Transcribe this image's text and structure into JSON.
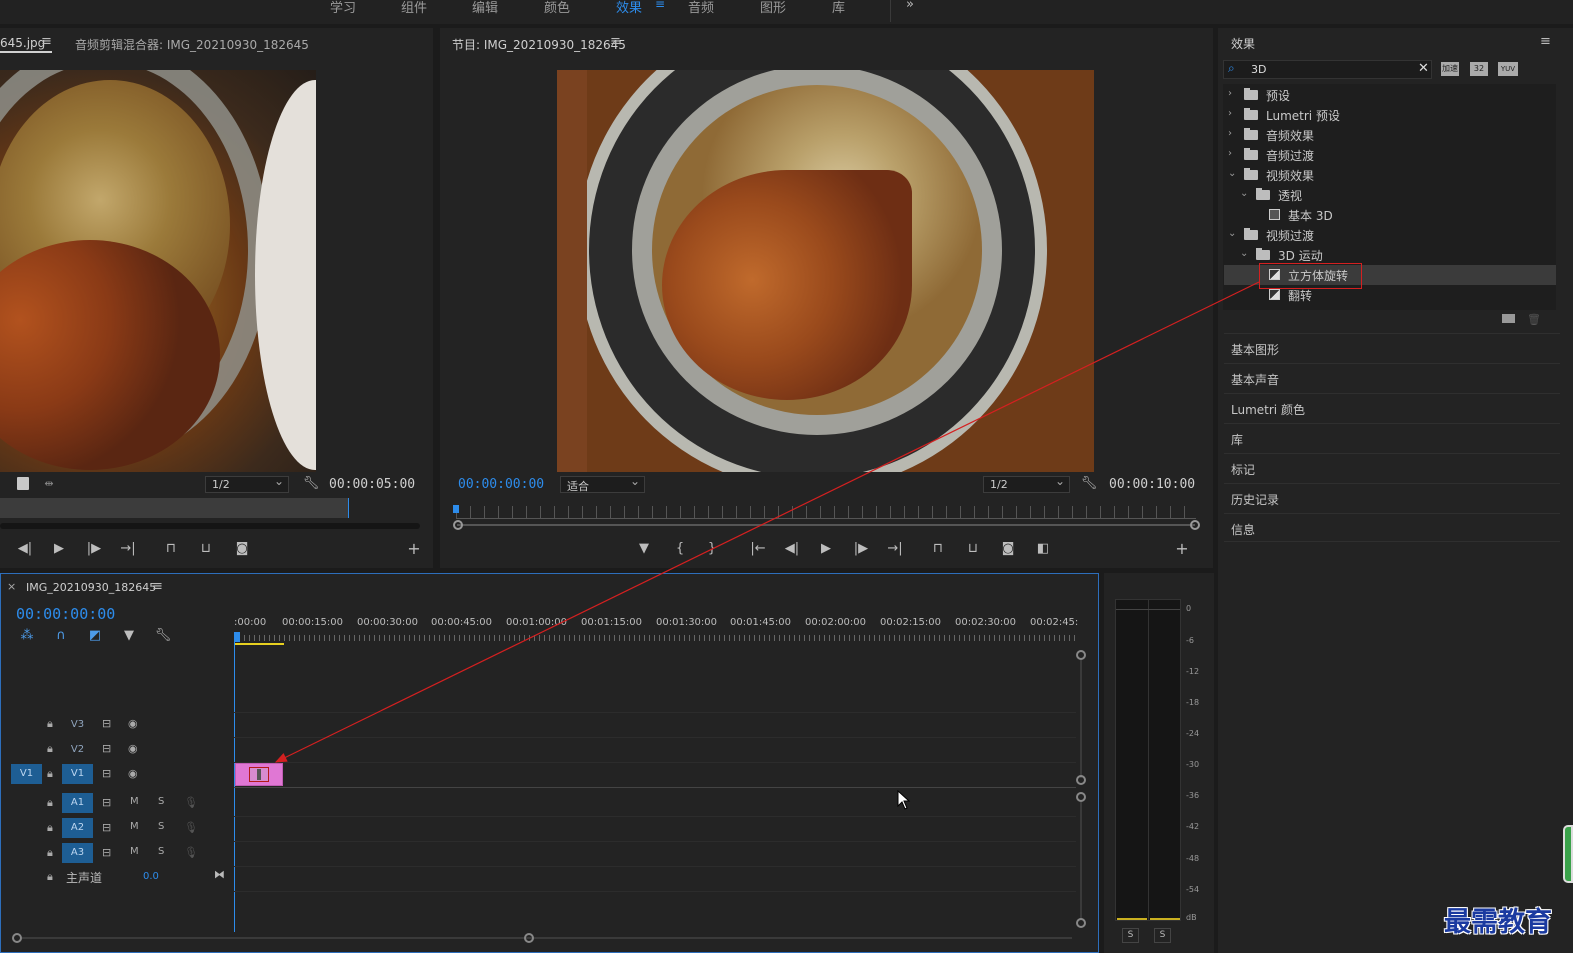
{
  "workspace_tabs": [
    {
      "label": "学习",
      "active": false
    },
    {
      "label": "组件",
      "active": false
    },
    {
      "label": "编辑",
      "active": false
    },
    {
      "label": "颜色",
      "active": false
    },
    {
      "label": "效果",
      "active": true
    },
    {
      "label": "音频",
      "active": false
    },
    {
      "label": "图形",
      "active": false
    },
    {
      "label": "库",
      "active": false
    }
  ],
  "workspace_more": "»",
  "source_panel": {
    "tab_clip": "645.jpg",
    "tab_mixer": "音频剪辑混合器: IMG_20210930_182645",
    "resolution": "1/2",
    "duration": "00:00:05:00"
  },
  "program_panel": {
    "title": "节目: IMG_20210930_182645",
    "timecode": "00:00:00:00",
    "fit": "适合",
    "resolution": "1/2",
    "duration": "00:00:10:00"
  },
  "effects_panel": {
    "title": "效果",
    "search_value": "3D",
    "filter_icons": [
      "加速",
      "32",
      "YUV"
    ],
    "tree": [
      {
        "label": "预设",
        "level": 0,
        "expanded": false,
        "kind": "preset"
      },
      {
        "label": "Lumetri 预设",
        "level": 0,
        "expanded": false,
        "kind": "preset"
      },
      {
        "label": "音频效果",
        "level": 0,
        "expanded": false,
        "kind": "folder"
      },
      {
        "label": "音频过渡",
        "level": 0,
        "expanded": false,
        "kind": "folder"
      },
      {
        "label": "视频效果",
        "level": 0,
        "expanded": true,
        "kind": "folder"
      },
      {
        "label": "透视",
        "level": 1,
        "expanded": true,
        "kind": "folder"
      },
      {
        "label": "基本 3D",
        "level": 2,
        "kind": "effect"
      },
      {
        "label": "视频过渡",
        "level": 0,
        "expanded": true,
        "kind": "folder"
      },
      {
        "label": "3D 运动",
        "level": 1,
        "expanded": true,
        "kind": "folder"
      },
      {
        "label": "立方体旋转",
        "level": 2,
        "kind": "transition",
        "selected": true
      },
      {
        "label": "翻转",
        "level": 2,
        "kind": "transition"
      }
    ]
  },
  "side_panels": [
    "基本图形",
    "基本声音",
    "Lumetri 颜色",
    "库",
    "标记",
    "历史记录",
    "信息"
  ],
  "timeline": {
    "sequence": "IMG_20210930_182645",
    "timecode": "00:00:00:00",
    "ruler_labels": [
      ":00:00",
      "00:00:15:00",
      "00:00:30:00",
      "00:00:45:00",
      "00:01:00:00",
      "00:01:15:00",
      "00:01:30:00",
      "00:01:45:00",
      "00:02:00:00",
      "00:02:15:00",
      "00:02:30:00",
      "00:02:45:"
    ],
    "video_tracks": [
      "V3",
      "V2",
      "V1"
    ],
    "source_patch": "V1",
    "audio_tracks": [
      "A1",
      "A2",
      "A3"
    ],
    "mute": "M",
    "solo": "S",
    "master_label": "主声道",
    "master_value": "0.0"
  },
  "audio_meter": {
    "scale": [
      "0",
      "-6",
      "-12",
      "-18",
      "-24",
      "-30",
      "-36",
      "-42",
      "-48",
      "-54",
      "dB"
    ],
    "solo_buttons": [
      "S",
      "S"
    ]
  },
  "watermark": "最需教育",
  "colors": {
    "accent": "#2d8ceb",
    "clip": "#e077d4",
    "annotation": "#d42020",
    "track_on": "#1e5e94"
  }
}
